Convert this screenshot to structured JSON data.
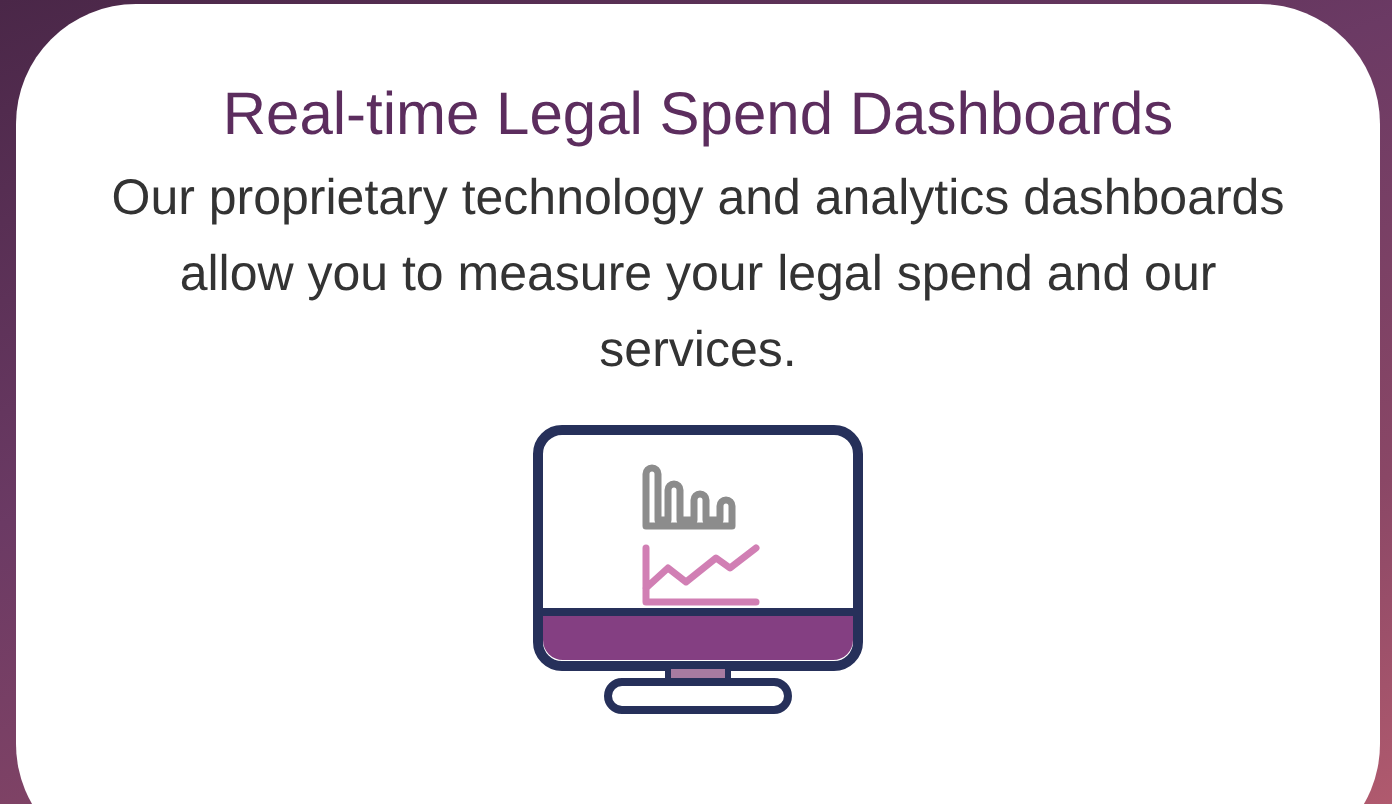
{
  "card": {
    "title": "Real-time Legal Spend Dashboards",
    "text": "Our proprietary technology and analytics dashboards allow you to measure your legal spend and our services."
  }
}
